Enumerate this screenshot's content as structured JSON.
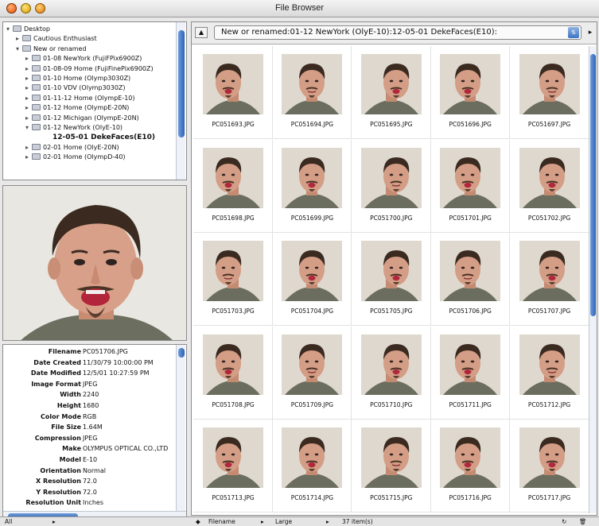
{
  "window": {
    "title": "File Browser"
  },
  "tree": {
    "items": [
      {
        "label": "Desktop",
        "indent": 0,
        "open": true
      },
      {
        "label": "Cautious Enthusiast",
        "indent": 1,
        "open": false
      },
      {
        "label": "New or renamed",
        "indent": 1,
        "open": true
      },
      {
        "label": "01-08 NewYork (FujiFPix6900Z)",
        "indent": 2,
        "open": false
      },
      {
        "label": "01-08-09 Home (FujiFinePix6900Z)",
        "indent": 2,
        "open": false
      },
      {
        "label": "01-10 Home (Olymp3030Z)",
        "indent": 2,
        "open": false
      },
      {
        "label": "01-10 VDV (Olymp3030Z)",
        "indent": 2,
        "open": false
      },
      {
        "label": "01-11-12 Home (OlympE-10)",
        "indent": 2,
        "open": false
      },
      {
        "label": "01-12 Home (OlympE-20N)",
        "indent": 2,
        "open": false
      },
      {
        "label": "01-12 Michigan (OlympE-20N)",
        "indent": 2,
        "open": false
      },
      {
        "label": "01-12 NewYork (OlyE-10)",
        "indent": 2,
        "open": true
      },
      {
        "label": "12-05-01 DekeFaces(E10)",
        "indent": 3,
        "open": false,
        "selected": true
      },
      {
        "label": "02-01 Home (OlyE-20N)",
        "indent": 2,
        "open": false
      },
      {
        "label": "02-01 Home (OlympD-40)",
        "indent": 2,
        "open": false
      }
    ]
  },
  "metadata": {
    "rows": [
      {
        "k": "Filename",
        "v": "PC051706.JPG"
      },
      {
        "k": "Date Created",
        "v": "11/30/79 10:00:00 PM"
      },
      {
        "k": "Date Modified",
        "v": "12/5/01 10:27:59 PM"
      },
      {
        "k": "Image Format",
        "v": "JPEG"
      },
      {
        "k": "Width",
        "v": "2240"
      },
      {
        "k": "Height",
        "v": "1680"
      },
      {
        "k": "Color Mode",
        "v": "RGB"
      },
      {
        "k": "File Size",
        "v": "1.64M"
      },
      {
        "k": "Compression",
        "v": "JPEG"
      },
      {
        "k": "Make",
        "v": "OLYMPUS OPTICAL CO.,LTD"
      },
      {
        "k": "Model",
        "v": "E-10"
      },
      {
        "k": "Orientation",
        "v": "Normal"
      },
      {
        "k": "X Resolution",
        "v": "72.0"
      },
      {
        "k": "Y Resolution",
        "v": "72.0"
      },
      {
        "k": "Resolution Unit",
        "v": "Inches"
      }
    ]
  },
  "pathbar": {
    "path": "New or renamed:01-12 NewYork (OlyE-10):12-05-01 DekeFaces(E10):"
  },
  "thumbnails": [
    "PC051693.JPG",
    "PC051694.JPG",
    "PC051695.JPG",
    "PC051696.JPG",
    "PC051697.JPG",
    "PC051698.JPG",
    "PC051699.JPG",
    "PC051700.JPG",
    "PC051701.JPG",
    "PC051702.JPG",
    "PC051703.JPG",
    "PC051704.JPG",
    "PC051705.JPG",
    "PC051706.JPG",
    "PC051707.JPG",
    "PC051708.JPG",
    "PC051709.JPG",
    "PC051710.JPG",
    "PC051711.JPG",
    "PC051712.JPG",
    "PC051713.JPG",
    "PC051714.JPG",
    "PC051715.JPG",
    "PC051716.JPG",
    "PC051717.JPG"
  ],
  "statusbar": {
    "show": "All",
    "sort": "Filename",
    "view": "Large",
    "count": "37 item(s)"
  }
}
